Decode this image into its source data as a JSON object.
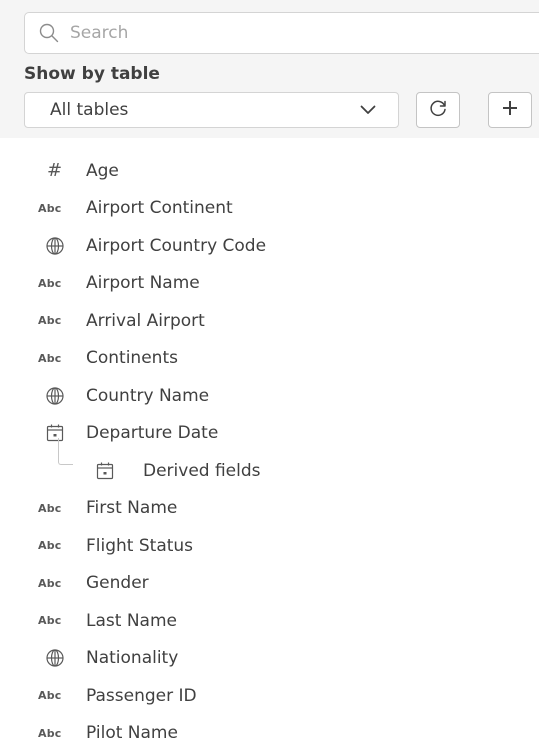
{
  "search": {
    "placeholder": "Search",
    "value": ""
  },
  "filter": {
    "label": "Show by table",
    "selected": "All tables"
  },
  "fields": [
    {
      "label": "Age",
      "type": "number",
      "icon": "hash-icon"
    },
    {
      "label": "Airport Continent",
      "type": "text",
      "icon": "abc-icon"
    },
    {
      "label": "Airport Country Code",
      "type": "geo",
      "icon": "globe-icon"
    },
    {
      "label": "Airport Name",
      "type": "text",
      "icon": "abc-icon"
    },
    {
      "label": "Arrival Airport",
      "type": "text",
      "icon": "abc-icon"
    },
    {
      "label": "Continents",
      "type": "text",
      "icon": "abc-icon"
    },
    {
      "label": "Country Name",
      "type": "geo",
      "icon": "globe-icon"
    },
    {
      "label": "Departure Date",
      "type": "date",
      "icon": "calendar-icon"
    },
    {
      "label": "Derived fields",
      "type": "derived",
      "icon": "calendar-icon"
    },
    {
      "label": "First Name",
      "type": "text",
      "icon": "abc-icon"
    },
    {
      "label": "Flight Status",
      "type": "text",
      "icon": "abc-icon"
    },
    {
      "label": "Gender",
      "type": "text",
      "icon": "abc-icon"
    },
    {
      "label": "Last Name",
      "type": "text",
      "icon": "abc-icon"
    },
    {
      "label": "Nationality",
      "type": "geo",
      "icon": "globe-icon"
    },
    {
      "label": "Passenger ID",
      "type": "text",
      "icon": "abc-icon"
    },
    {
      "label": "Pilot Name",
      "type": "text",
      "icon": "abc-icon"
    }
  ],
  "icons": {
    "abc_text": "Abc",
    "hash_text": "#"
  },
  "colors": {
    "panel": "#f5f5f5",
    "text": "#404040",
    "icon": "#595959",
    "border": "#d4d4d4"
  }
}
